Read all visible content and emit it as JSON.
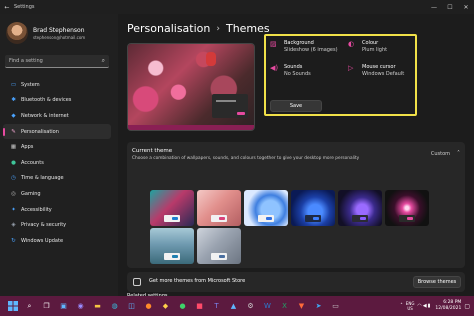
{
  "window": {
    "title": "Settings",
    "back_icon": "back-arrow-icon",
    "controls": [
      "minimize-icon",
      "maximize-icon",
      "close-icon"
    ]
  },
  "user": {
    "name": "Brad Stephenson",
    "email": "stephenson@hotmail.com"
  },
  "search": {
    "placeholder": "Find a setting"
  },
  "nav": [
    {
      "label": "System",
      "icon": "system-icon"
    },
    {
      "label": "Bluetooth & devices",
      "icon": "bluetooth-icon"
    },
    {
      "label": "Network & internet",
      "icon": "network-icon"
    },
    {
      "label": "Personalisation",
      "icon": "personalisation-icon",
      "active": true
    },
    {
      "label": "Apps",
      "icon": "apps-icon"
    },
    {
      "label": "Accounts",
      "icon": "accounts-icon"
    },
    {
      "label": "Time & language",
      "icon": "time-icon"
    },
    {
      "label": "Gaming",
      "icon": "gaming-icon"
    },
    {
      "label": "Accessibility",
      "icon": "accessibility-icon"
    },
    {
      "label": "Privacy & security",
      "icon": "privacy-icon"
    },
    {
      "label": "Windows Update",
      "icon": "update-icon"
    }
  ],
  "breadcrumb": {
    "parent": "Personalisation",
    "current": "Themes"
  },
  "properties": {
    "background": {
      "title": "Background",
      "value": "Slideshow (6 images)"
    },
    "colour": {
      "title": "Colour",
      "value": "Plum light"
    },
    "sounds": {
      "title": "Sounds",
      "value": "No Sounds"
    },
    "cursor": {
      "title": "Mouse cursor",
      "value": "Windows Default"
    },
    "save_label": "Save"
  },
  "current_theme": {
    "title": "Current theme",
    "subtitle": "Choose a combination of wallpapers, sounds, and colours together to give your desktop more personality",
    "value": "Custom",
    "themes_count": 8
  },
  "store": {
    "label": "Get more themes from Microsoft Store",
    "button": "Browse themes"
  },
  "related": {
    "label": "Related settings"
  },
  "taskbar": {
    "lang": [
      "ENG",
      "US"
    ],
    "time": "6:28 PM",
    "date": "12/08/2021"
  },
  "colors": {
    "accent": "#e64aa0",
    "highlight": "#f0e048",
    "taskbar": "#5c1a3f"
  }
}
